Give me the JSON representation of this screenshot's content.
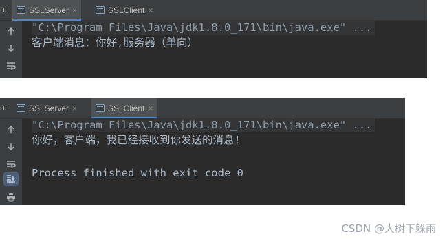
{
  "panel_1": {
    "tab_prefix": "n:",
    "tabs": [
      {
        "label": "SSLServer",
        "icon": "console-icon",
        "active": true
      },
      {
        "label": "SSLClient",
        "icon": "console-icon",
        "active": false
      }
    ],
    "gutter_icons": [
      "arrow-up-icon",
      "arrow-down-icon",
      "soft-wrap-icon"
    ],
    "lines": [
      "\"C:\\Program Files\\Java\\jdk1.8.0_171\\bin\\java.exe\" ...",
      "客户端消息：你好,服务器（单向）"
    ]
  },
  "panel_2": {
    "tab_prefix": "n:",
    "tabs": [
      {
        "label": "SSLServer",
        "icon": "console-icon",
        "active": false
      },
      {
        "label": "SSLClient",
        "icon": "console-icon",
        "active": true
      }
    ],
    "gutter_icons": [
      "arrow-up-icon",
      "arrow-down-icon",
      "soft-wrap-icon",
      "scroll-to-end-icon",
      "print-icon"
    ],
    "lines": [
      "\"C:\\Program Files\\Java\\jdk1.8.0_171\\bin\\java.exe\" ...",
      "你好，客户端，我已经接收到你发送的消息!",
      "",
      "Process finished with exit code 0"
    ]
  },
  "close_glyph": "×",
  "watermark": "CSDN @大树下躲雨",
  "colors": {
    "console_bg": "#2b2b2b",
    "toolbar_bg": "#3c3f41",
    "text": "#a9b7c6",
    "active_tab_underline": "#4a88c7"
  }
}
